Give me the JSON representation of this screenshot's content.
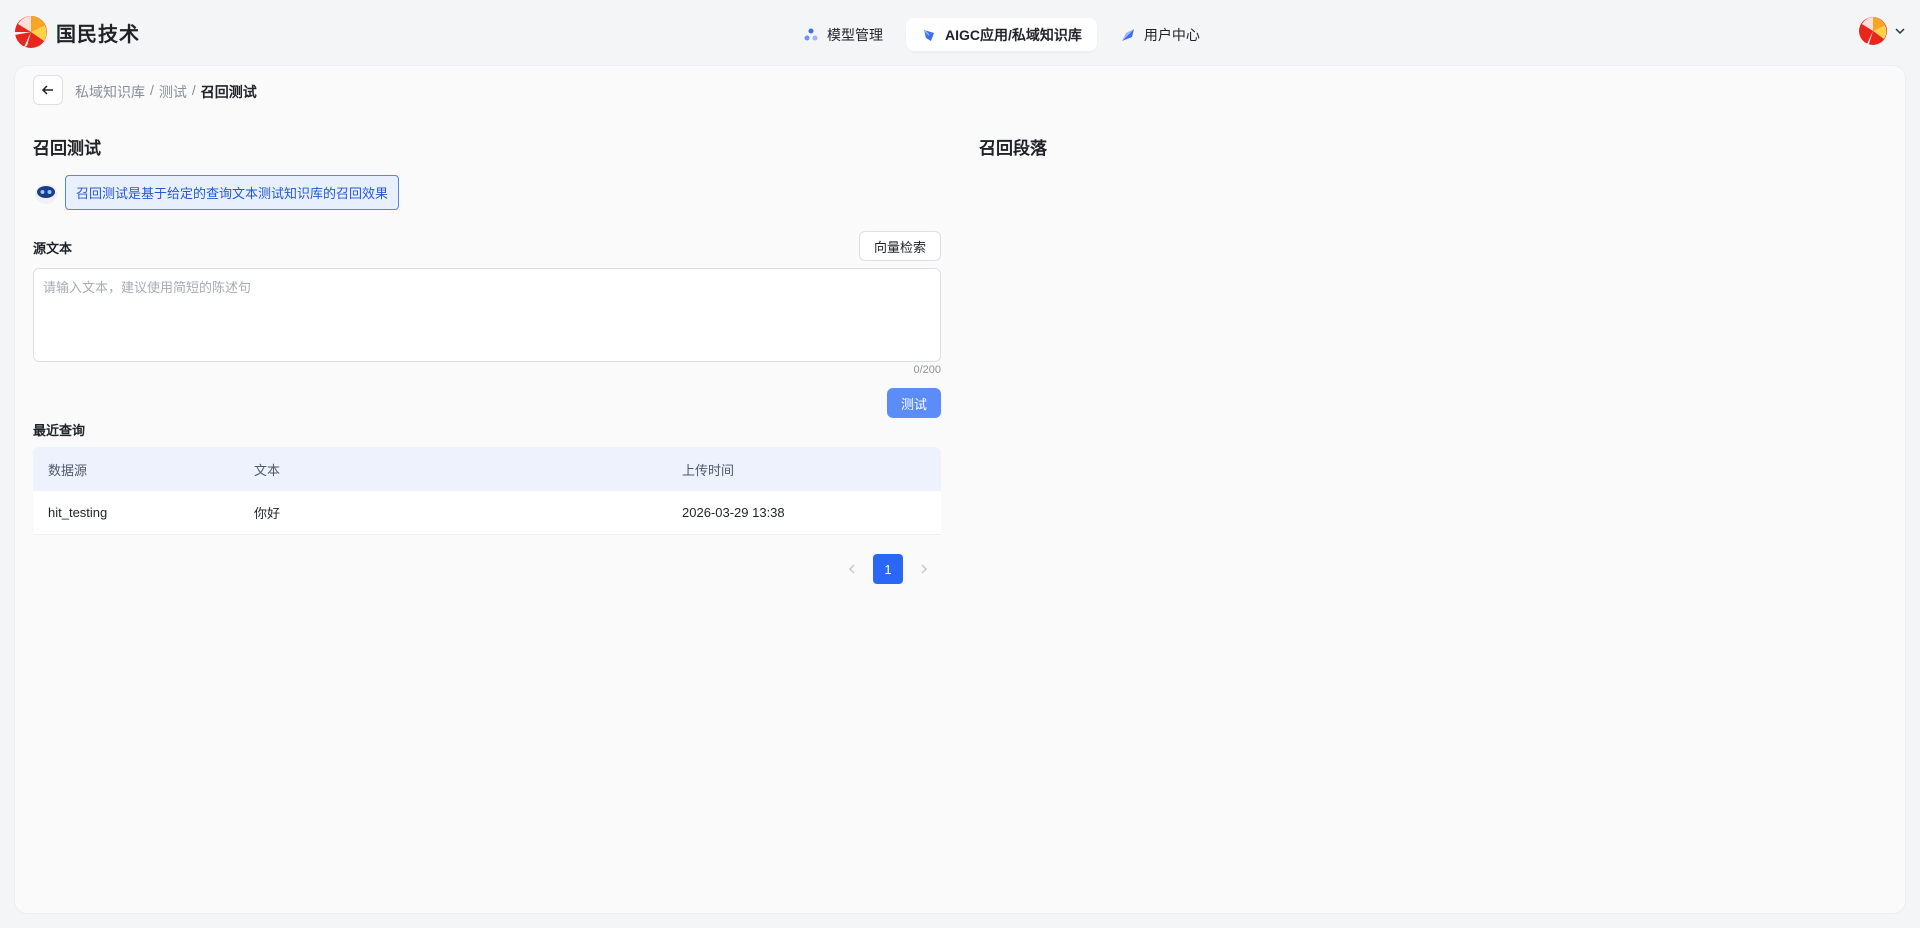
{
  "brand": {
    "name": "国民技术"
  },
  "nav": {
    "items": [
      {
        "label": "模型管理",
        "icon": "model-icon",
        "active": false
      },
      {
        "label": "AIGC应用/私域知识库",
        "icon": "knowledge-icon",
        "active": true
      },
      {
        "label": "用户中心",
        "icon": "user-center-icon",
        "active": false
      }
    ]
  },
  "breadcrumb": {
    "items": [
      "私域知识库",
      "测试",
      "召回测试"
    ],
    "separator": "/"
  },
  "left": {
    "title": "召回测试",
    "tip": "召回测试是基于给定的查询文本测试知识库的召回效果",
    "source_label": "源文本",
    "vector_button": "向量检索",
    "input_placeholder": "请输入文本，建议使用简短的陈述句",
    "input_value": "",
    "counter": "0/200",
    "test_button": "测试",
    "recent_label": "最近查询"
  },
  "right": {
    "title": "召回段落"
  },
  "table": {
    "columns": [
      "数据源",
      "文本",
      "上传时间"
    ],
    "rows": [
      [
        "hit_testing",
        "你好",
        "2026-03-29 13:38"
      ]
    ]
  },
  "pagination": {
    "current": "1"
  },
  "colors": {
    "primary": "#2b67f6",
    "button": "#5b8cf8",
    "tip_border": "#4a88f5"
  }
}
